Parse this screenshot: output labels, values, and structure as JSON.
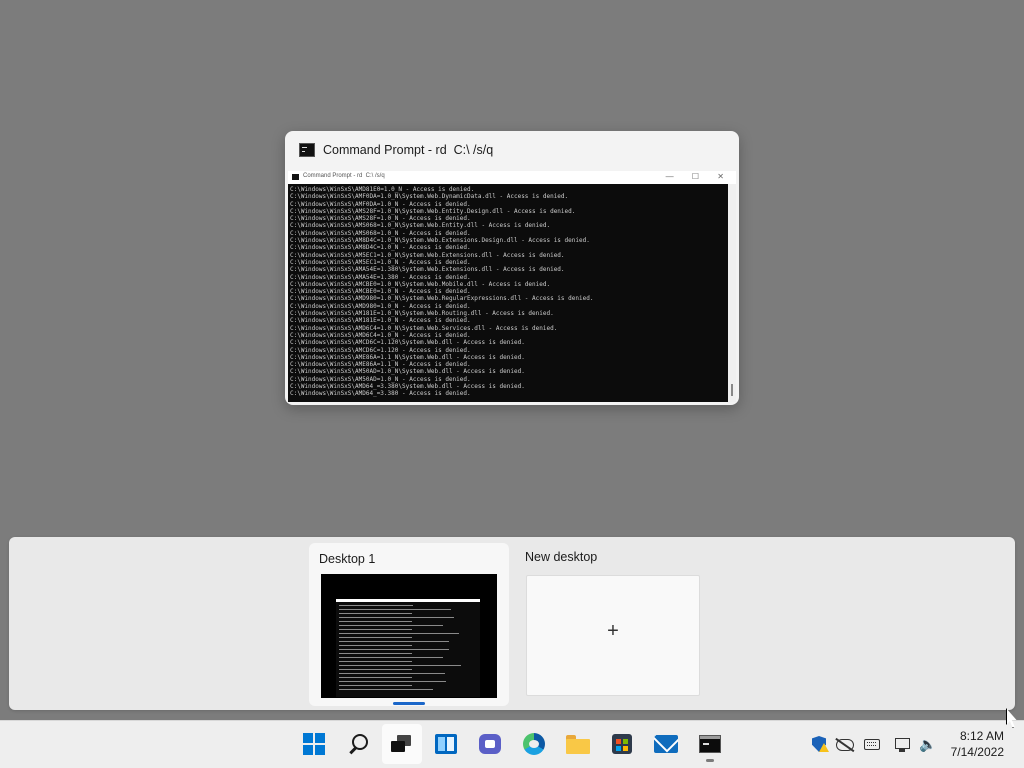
{
  "task_view": {
    "window": {
      "title": "Command Prompt - rd  C:\\ /s/q",
      "thumbnail_title": "Command Prompt - rd  C:\\ /s/q",
      "thumbnail_controls": "—  ☐  ✕",
      "console_lines": [
        "C:\\Windows\\WinSxS\\AMD81E0=1.0_N - Access is denied.",
        "C:\\Windows\\WinSxS\\AMF0DA=1.0_N\\System.Web.DynamicData.dll - Access is denied.",
        "C:\\Windows\\WinSxS\\AMF0DA=1.0_N - Access is denied.",
        "C:\\Windows\\WinSxS\\AMS28F=1.0_N\\System.Web.Entity.Design.dll - Access is denied.",
        "C:\\Windows\\WinSxS\\AMS28F=1.0_N - Access is denied.",
        "C:\\Windows\\WinSxS\\AMS068=1.0_N\\System.Web.Entity.dll - Access is denied.",
        "C:\\Windows\\WinSxS\\AMS068=1.0_N - Access is denied.",
        "C:\\Windows\\WinSxS\\AM8D4C=1.0_N\\System.Web.Extensions.Design.dll - Access is denied.",
        "C:\\Windows\\WinSxS\\AM8D4C=1.0_N - Access is denied.",
        "C:\\Windows\\WinSxS\\AM5EC1=1.0_N\\System.Web.Extensions.dll - Access is denied.",
        "C:\\Windows\\WinSxS\\AM5EC1=1.0_N - Access is denied.",
        "C:\\Windows\\WinSxS\\AMA54E=1.380\\System.Web.Extensions.dll - Access is denied.",
        "C:\\Windows\\WinSxS\\AMA54E=1.380 - Access is denied.",
        "C:\\Windows\\WinSxS\\AMCBE0=1.0_N\\System.Web.Mobile.dll - Access is denied.",
        "C:\\Windows\\WinSxS\\AMCBE0=1.0_N - Access is denied.",
        "C:\\Windows\\WinSxS\\AMD980=1.0_N\\System.Web.RegularExpressions.dll - Access is denied.",
        "C:\\Windows\\WinSxS\\AMD980=1.0_N - Access is denied.",
        "C:\\Windows\\WinSxS\\AM181E=1.0_N\\System.Web.Routing.dll - Access is denied.",
        "C:\\Windows\\WinSxS\\AM181E=1.0_N - Access is denied.",
        "C:\\Windows\\WinSxS\\AMD6C4=1.0_N\\System.Web.Services.dll - Access is denied.",
        "C:\\Windows\\WinSxS\\AMD6C4=1.0_N - Access is denied.",
        "C:\\Windows\\WinSxS\\AMCD6C=1.120\\System.Web.dll - Access is denied.",
        "C:\\Windows\\WinSxS\\AMCD6C=1.120 - Access is denied.",
        "C:\\Windows\\WinSxS\\AME86A=1.1_N\\System.Web.dll - Access is denied.",
        "C:\\Windows\\WinSxS\\AME86A=1.1_N - Access is denied.",
        "C:\\Windows\\WinSxS\\AM50AD=1.0_N\\System.Web.dll - Access is denied.",
        "C:\\Windows\\WinSxS\\AM50AD=1.0_N - Access is denied.",
        "C:\\Windows\\WinSxS\\AMD64_=3.380\\System.Web.dll - Access is denied.",
        "C:\\Windows\\WinSxS\\AMD64_=3.380 - Access is denied."
      ]
    },
    "desktops": [
      {
        "label": "Desktop 1",
        "active": true
      },
      {
        "label": "New desktop",
        "plus": "+"
      }
    ]
  },
  "taskbar": {
    "apps": [
      {
        "name": "start-button",
        "icon": "windows-logo-icon"
      },
      {
        "name": "search-button",
        "icon": "search-icon"
      },
      {
        "name": "task-view-button",
        "icon": "task-view-icon",
        "active": true
      },
      {
        "name": "widgets-button",
        "icon": "widgets-icon"
      },
      {
        "name": "chat-button",
        "icon": "teams-chat-icon"
      },
      {
        "name": "edge-button",
        "icon": "edge-icon"
      },
      {
        "name": "file-explorer-button",
        "icon": "folder-icon"
      },
      {
        "name": "store-button",
        "icon": "store-icon"
      },
      {
        "name": "mail-button",
        "icon": "mail-icon"
      },
      {
        "name": "command-prompt-button",
        "icon": "cmd-icon",
        "running": true
      }
    ],
    "tray": {
      "icons": [
        "security-warning-icon",
        "cloud-offline-icon",
        "keyboard-icon",
        "network-icon",
        "volume-icon"
      ],
      "time": "8:12 AM",
      "date": "7/14/2022"
    }
  },
  "colors": {
    "desktop_bg": "#7c7c7c",
    "accent": "#0078d4"
  }
}
